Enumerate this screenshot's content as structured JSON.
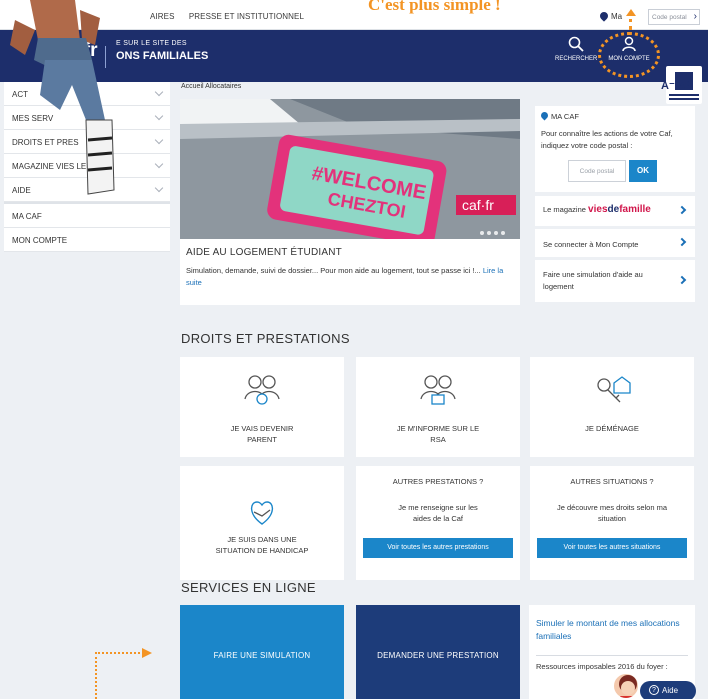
{
  "topbar": {
    "links": [
      "AIRES",
      "PRESSE ET INSTITUTIONNEL"
    ],
    "location_label": "Ma",
    "postal_placeholder": "Code postal",
    "tagline": "C'est plus simple !"
  },
  "header": {
    "logo_text": "caf·fr",
    "welcome_line1": "E SUR LE SITE DES",
    "welcome_line2": "ONS FAMILIALES",
    "search_label": "RECHERCHER",
    "account_label": "MON COMPTE"
  },
  "menu": {
    "items": [
      {
        "label": "ACT"
      },
      {
        "label": "MES SERV"
      },
      {
        "label": "DROITS ET PRES"
      },
      {
        "label": "MAGAZINE VIES        LE"
      },
      {
        "label": "AIDE"
      }
    ],
    "plain_items": [
      {
        "label": "MA CAF"
      },
      {
        "label": "MON COMPTE"
      }
    ]
  },
  "breadcrumb": "Accueil Allocataires",
  "font_size_controls": "A⁻  A⁺",
  "hero": {
    "doormat_line1": "#WELCOME",
    "doormat_line2": "CHEZTOI",
    "badge": "caf·fr",
    "caption": "AIDE AU LOGEMENT ÉTUDIANT",
    "text": "Simulation, demande, suivi de dossier... Pour mon aide au logement, tout se passe ici !...",
    "read_more": "Lire la suite"
  },
  "macaf": {
    "title": "MA CAF",
    "description": "Pour connaître les actions de votre Caf, indiquez votre code postal :",
    "postal_placeholder": "Code postal",
    "ok_label": "OK"
  },
  "right_links": {
    "magazine_prefix": "Le magazine",
    "magazine_brand_1": "vies",
    "magazine_brand_2": "de",
    "magazine_brand_3": "famille",
    "connect": "Se connecter à Mon Compte",
    "simulate": "Faire une simulation d'aide au logement"
  },
  "droits": {
    "title": "DROITS ET PRESTATIONS",
    "cards": [
      {
        "label": "JE VAIS DEVENIR PARENT"
      },
      {
        "label": "JE M'INFORME SUR LE RSA"
      },
      {
        "label": "JE DÉMÉNAGE"
      },
      {
        "label": "JE SUIS DANS UNE SITUATION DE HANDICAP"
      }
    ],
    "autres_prestations": {
      "title": "AUTRES PRESTATIONS ?",
      "text": "Je me renseigne sur les aides de la Caf",
      "button": "Voir toutes les autres prestations"
    },
    "autres_situations": {
      "title": "AUTRES SITUATIONS ?",
      "text": "Je découvre mes droits selon ma situation",
      "button": "Voir toutes les autres situations"
    }
  },
  "services": {
    "title": "SERVICES EN LIGNE",
    "simulation": "FAIRE UNE SIMULATION",
    "demande": "DEMANDER UNE PRESTATION",
    "simulator_title": "Simuler le montant de mes allocations familiales",
    "simulator_text": "Ressources imposables 2016 du foyer :",
    "help_label": "Aide"
  },
  "colors": {
    "brand": "#1d2e6b",
    "accent": "#1b86c9",
    "highlight": "#f39424"
  }
}
